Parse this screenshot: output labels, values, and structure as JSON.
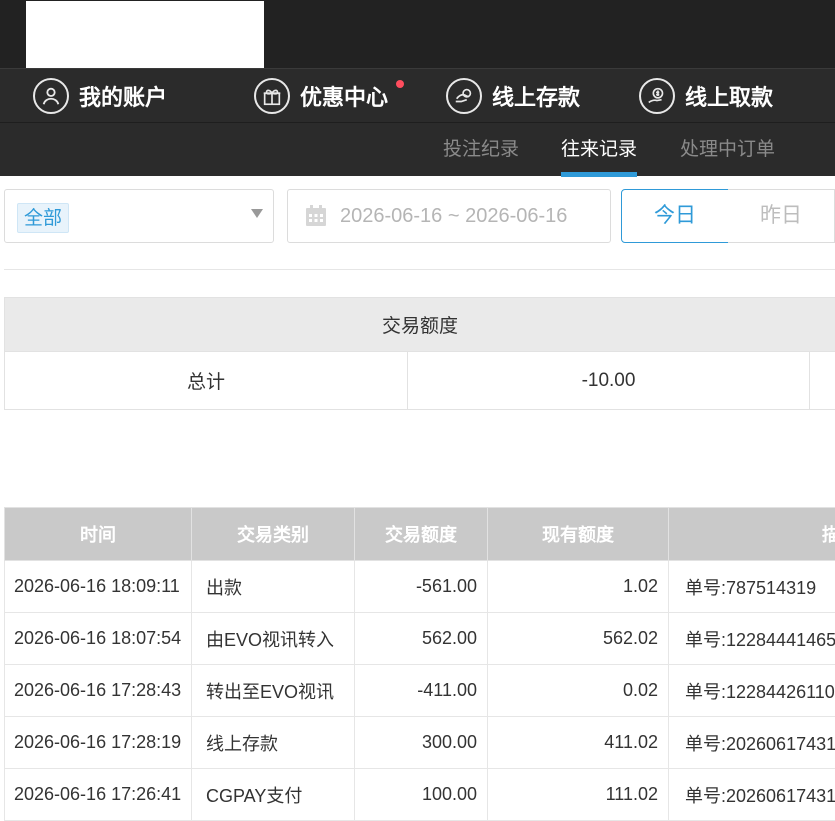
{
  "nav": {
    "items": [
      {
        "label": "我的账户",
        "icon": "user-icon"
      },
      {
        "label": "优惠中心",
        "icon": "gift-icon",
        "has_dot": true
      },
      {
        "label": "线上存款",
        "icon": "deposit-icon"
      },
      {
        "label": "线上取款",
        "icon": "withdraw-icon"
      }
    ]
  },
  "subnav": {
    "tabs": [
      {
        "label": "投注纪录",
        "active": false
      },
      {
        "label": "往来记录",
        "active": true
      },
      {
        "label": "处理中订单",
        "active": false
      }
    ]
  },
  "filters": {
    "type_selected": "全部",
    "date_range": "2026-06-16 ~ 2026-06-16",
    "today_label": "今日",
    "yesterday_label": "昨日",
    "active_button": "今日"
  },
  "summary": {
    "header": "交易额度",
    "row_label": "总计",
    "row_value": "-10.00"
  },
  "table": {
    "headers": [
      "时间",
      "交易类别",
      "交易额度",
      "现有额度",
      "描"
    ],
    "rows": [
      {
        "time": "2026-06-16 18:09:11",
        "type": "出款",
        "amount": "-561.00",
        "balance": "1.02",
        "memo": "单号:787514319"
      },
      {
        "time": "2026-06-16 18:07:54",
        "type": "由EVO视讯转入",
        "amount": "562.00",
        "balance": "562.02",
        "memo": "单号:12284441465"
      },
      {
        "time": "2026-06-16 17:28:43",
        "type": "转出至EVO视讯",
        "amount": "-411.00",
        "balance": "0.02",
        "memo": "单号:12284426110"
      },
      {
        "time": "2026-06-16 17:28:19",
        "type": "线上存款",
        "amount": "300.00",
        "balance": "411.02",
        "memo": "单号:20260617431"
      },
      {
        "time": "2026-06-16 17:26:41",
        "type": "CGPAY支付",
        "amount": "100.00",
        "balance": "111.02",
        "memo": "单号:20260617431"
      }
    ]
  },
  "colors": {
    "accent": "#2f9ad8",
    "header_bg": "#222222",
    "nav_bg": "#2b2b2b",
    "notify_dot": "#ff4d5e"
  }
}
